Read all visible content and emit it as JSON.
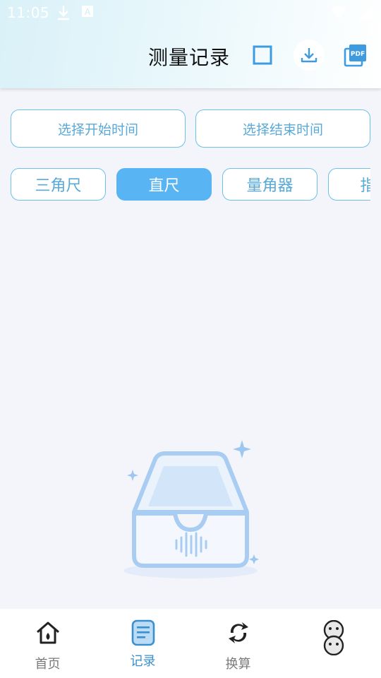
{
  "status_bar": {
    "time": "11:05",
    "icons": [
      "download-icon",
      "font-icon",
      "wifi-icon",
      "battery-icon"
    ]
  },
  "header": {
    "title": "测量记录",
    "actions": [
      {
        "name": "select-checkbox",
        "icon": "square-icon"
      },
      {
        "name": "download-button",
        "icon": "download-icon"
      },
      {
        "name": "pdf-button",
        "icon": "pdf-icon",
        "text": "PDF"
      }
    ]
  },
  "date_range": {
    "start_label": "选择开始时间",
    "end_label": "选择结束时间"
  },
  "tabs": [
    {
      "label": "三角尺",
      "active": false
    },
    {
      "label": "直尺",
      "active": true
    },
    {
      "label": "量角器",
      "active": false
    },
    {
      "label": "指南",
      "active": false
    }
  ],
  "empty_state": {
    "icon": "empty-inbox-icon"
  },
  "bottom_nav": [
    {
      "label": "首页",
      "icon": "home-icon",
      "active": false
    },
    {
      "label": "记录",
      "icon": "record-icon",
      "active": true
    },
    {
      "label": "换算",
      "icon": "convert-icon",
      "active": false
    },
    {
      "label": "",
      "icon": "profile-icon",
      "active": false
    }
  ],
  "colors": {
    "accent": "#58b4f2",
    "border": "#6ec0e8",
    "text_accent": "#5aa9d6",
    "nav_active": "#3a8fcf",
    "background": "#f3f5fa"
  }
}
